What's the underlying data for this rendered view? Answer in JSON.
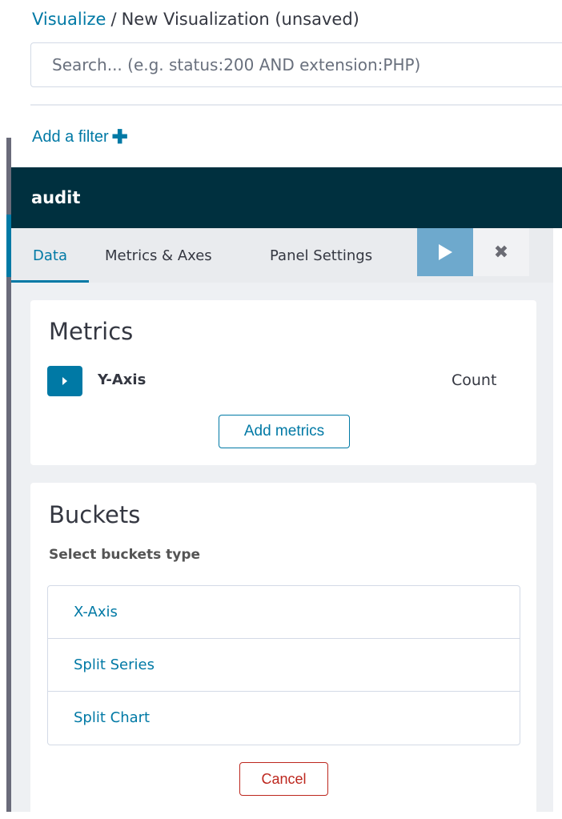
{
  "breadcrumb": {
    "root": "Visualize",
    "separator": "/",
    "current": "New Visualization (unsaved)"
  },
  "search": {
    "value": "",
    "placeholder": "Search... (e.g. status:200 AND extension:PHP)"
  },
  "filter": {
    "add_label": "Add a filter",
    "icon": "plus-icon"
  },
  "panel": {
    "title": "audit",
    "tabs": [
      {
        "label": "Data",
        "active": true
      },
      {
        "label": "Metrics & Axes",
        "active": false
      },
      {
        "label": "Panel Settings",
        "active": false
      }
    ],
    "apply_icon": "play-icon",
    "discard_icon": "close-icon"
  },
  "metrics": {
    "title": "Metrics",
    "items": [
      {
        "label": "Y-Axis",
        "value": "Count",
        "icon": "caret-right-icon"
      }
    ],
    "add_button": "Add metrics"
  },
  "buckets": {
    "title": "Buckets",
    "subtitle": "Select buckets type",
    "options": [
      "X-Axis",
      "Split Series",
      "Split Chart"
    ],
    "cancel_button": "Cancel"
  },
  "colors": {
    "accent": "#0079a5",
    "header_bg": "#00303f",
    "apply_bg": "#6ea9cd",
    "danger": "#bd271e"
  }
}
